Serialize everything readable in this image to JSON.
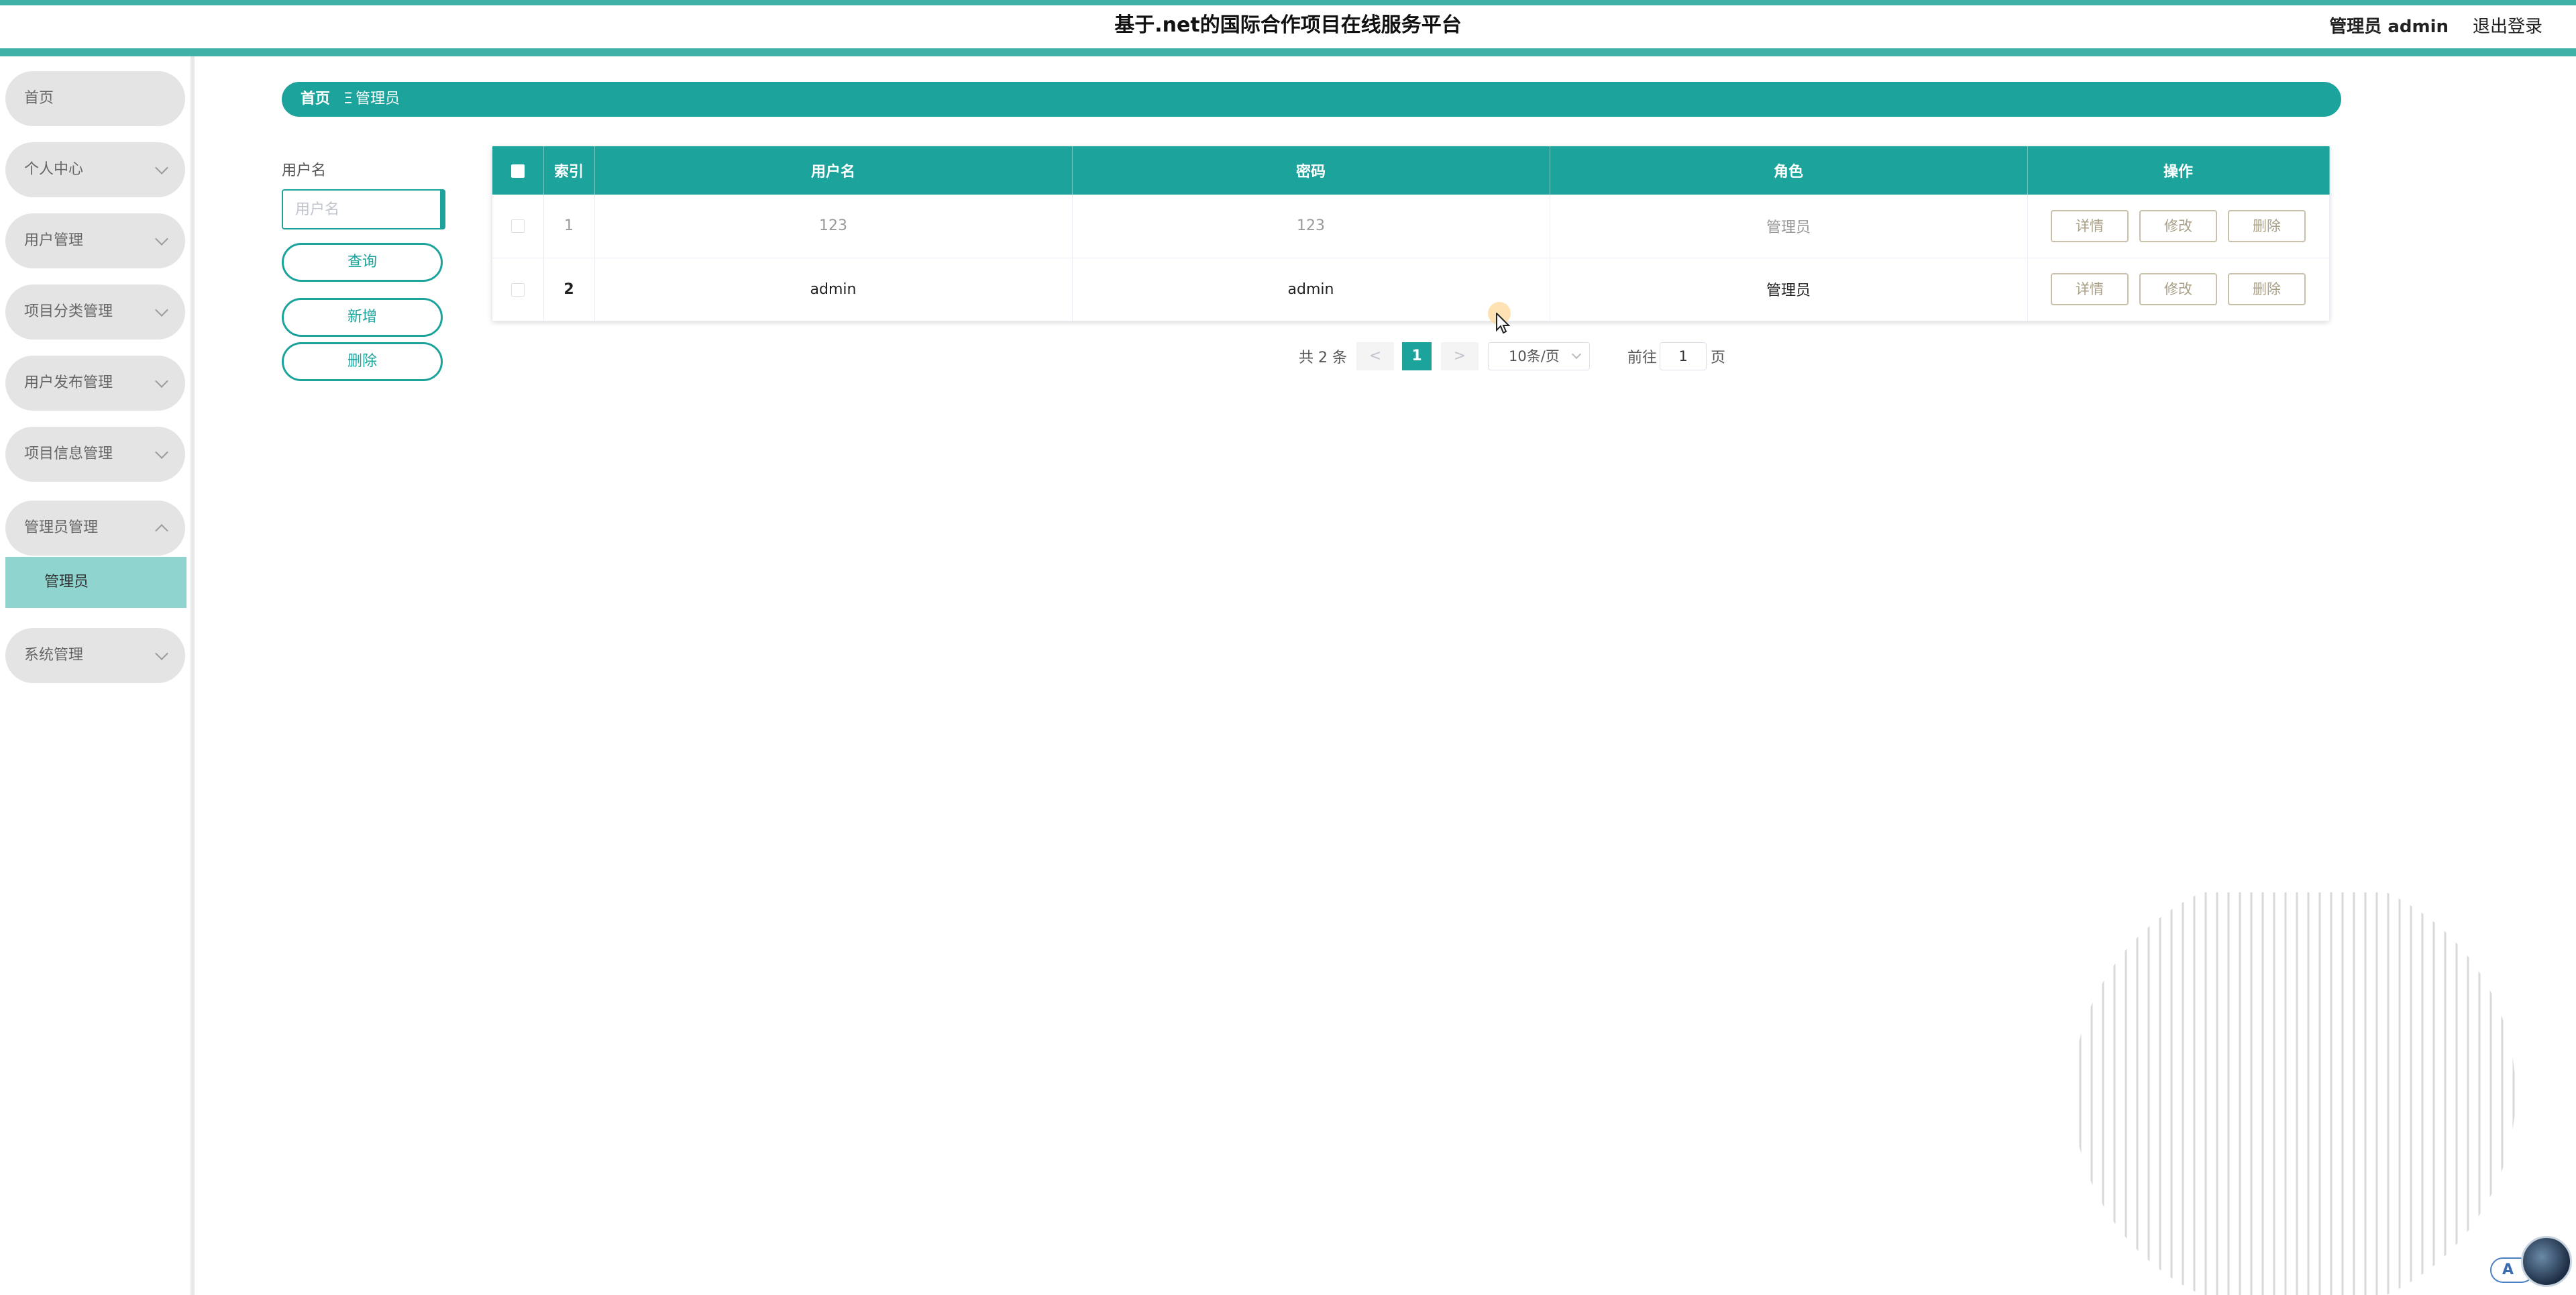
{
  "header": {
    "title": "基于.net的国际合作项目在线服务平台",
    "user_info": "管理员 admin",
    "logout_label": "退出登录"
  },
  "sidebar": {
    "items": [
      {
        "label": "首页"
      },
      {
        "label": "个人中心"
      },
      {
        "label": "用户管理"
      },
      {
        "label": "项目分类管理"
      },
      {
        "label": "用户发布管理"
      },
      {
        "label": "项目信息管理"
      },
      {
        "label": "管理员管理"
      },
      {
        "label": "系统管理"
      }
    ],
    "active_sub": "管理员"
  },
  "breadcrumb": {
    "home": "首页",
    "separator": "Ξ",
    "current": "管理员"
  },
  "search": {
    "label": "用户名",
    "placeholder": "用户名",
    "query_label": "查询",
    "add_label": "新增",
    "delete_label": "删除"
  },
  "table": {
    "columns": [
      "索引",
      "用户名",
      "密码",
      "角色",
      "操作"
    ],
    "rows": [
      {
        "index": "1",
        "username": "123",
        "password": "123",
        "role": "管理员"
      },
      {
        "index": "2",
        "username": "admin",
        "password": "admin",
        "role": "管理员"
      }
    ],
    "actions": {
      "detail": "详情",
      "edit": "修改",
      "delete": "删除"
    }
  },
  "pagination": {
    "total": "共 2 条",
    "prev": "<",
    "page": "1",
    "next": ">",
    "page_size": "10条/页",
    "goto": "前往",
    "goto_value": "1",
    "unit": "页"
  },
  "float_badge": "A",
  "colors": {
    "accent": "#1ba39c",
    "accent_light": "#8fd4cf",
    "menu_bg": "#e4e4e4"
  }
}
